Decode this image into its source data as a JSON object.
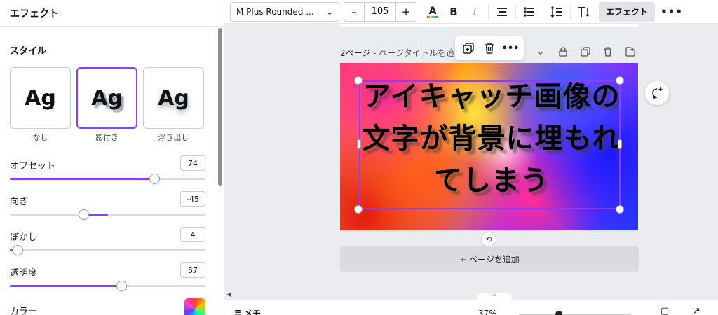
{
  "panel": {
    "title": "エフェクト",
    "section_title": "スタイル",
    "styles": [
      {
        "sample": "Ag",
        "label": "なし"
      },
      {
        "sample": "Ag",
        "label": "影付き"
      },
      {
        "sample": "Ag",
        "label": "浮き出し"
      }
    ],
    "sliders": [
      {
        "label": "オフセット",
        "value": "74",
        "fraction": 0.74
      },
      {
        "label": "向き",
        "value": "-45",
        "fraction": 0.375
      },
      {
        "label": "ぼかし",
        "value": "4",
        "fraction": 0.04
      },
      {
        "label": "透明度",
        "value": "57",
        "fraction": 0.57
      }
    ],
    "color_label": "カラー"
  },
  "toolbar": {
    "font": "M Plus Rounded ...",
    "minus": "–",
    "size": "105",
    "plus": "+",
    "effect_label": "エフェクト"
  },
  "canvas": {
    "page_number": "2ページ",
    "page_title_placeholder": " - ページタイトルを追",
    "design_text": "アイキャッチ画像の文字が背景に埋もれてしまう",
    "add_page": "+ ページを追加"
  },
  "footer": {
    "notes": "メモ",
    "zoom": "37%"
  },
  "colors": {
    "accent": "#8b3dff"
  }
}
